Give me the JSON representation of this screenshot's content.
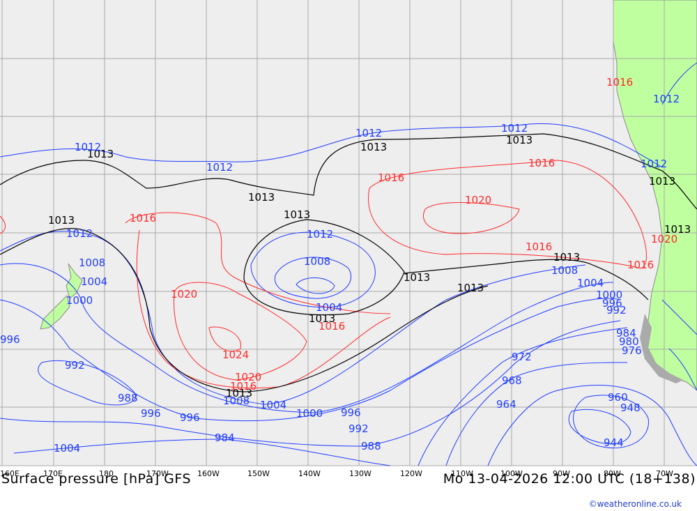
{
  "title": "Surface pressure [hPa] GFS",
  "datetime": "Mo 13-04-2026 12:00 UTC (18+138)",
  "credit": "©weatheronline.co.uk",
  "colors": {
    "ocean": "#eeeeee",
    "land": "#bfff9f",
    "grid": "#a0a0a0",
    "low_isobars": "#1f3cff",
    "high_isobars": "#ff2a2a",
    "standard_isobar": "#000000"
  },
  "longitude_ticks": [
    "160E",
    "170E",
    "180",
    "170W",
    "160W",
    "150W",
    "140W",
    "130W",
    "120W",
    "110W",
    "100W",
    "90W",
    "80W",
    "70W"
  ],
  "isobar_labels": {
    "black": [
      "1013",
      "1013",
      "1013",
      "1013",
      "1013",
      "1013",
      "1013",
      "1013",
      "1013",
      "1013",
      "1013",
      "1013",
      "1013"
    ],
    "blue": [
      "1012",
      "1012",
      "1012",
      "1012",
      "1012",
      "1012",
      "1012",
      "1012",
      "1008",
      "1008",
      "1008",
      "1004",
      "1004",
      "1004",
      "1004",
      "1000",
      "1000",
      "1000",
      "996",
      "996",
      "996",
      "996",
      "996",
      "992",
      "992",
      "992",
      "988",
      "988",
      "984",
      "984",
      "980",
      "976",
      "972",
      "968",
      "964",
      "960",
      "948",
      "944",
      "1004",
      "1008"
    ],
    "red": [
      "1016",
      "1016",
      "1016",
      "1016",
      "1016",
      "1016",
      "1016",
      "1020",
      "1020",
      "1020",
      "1020",
      "1024",
      "1016"
    ]
  }
}
